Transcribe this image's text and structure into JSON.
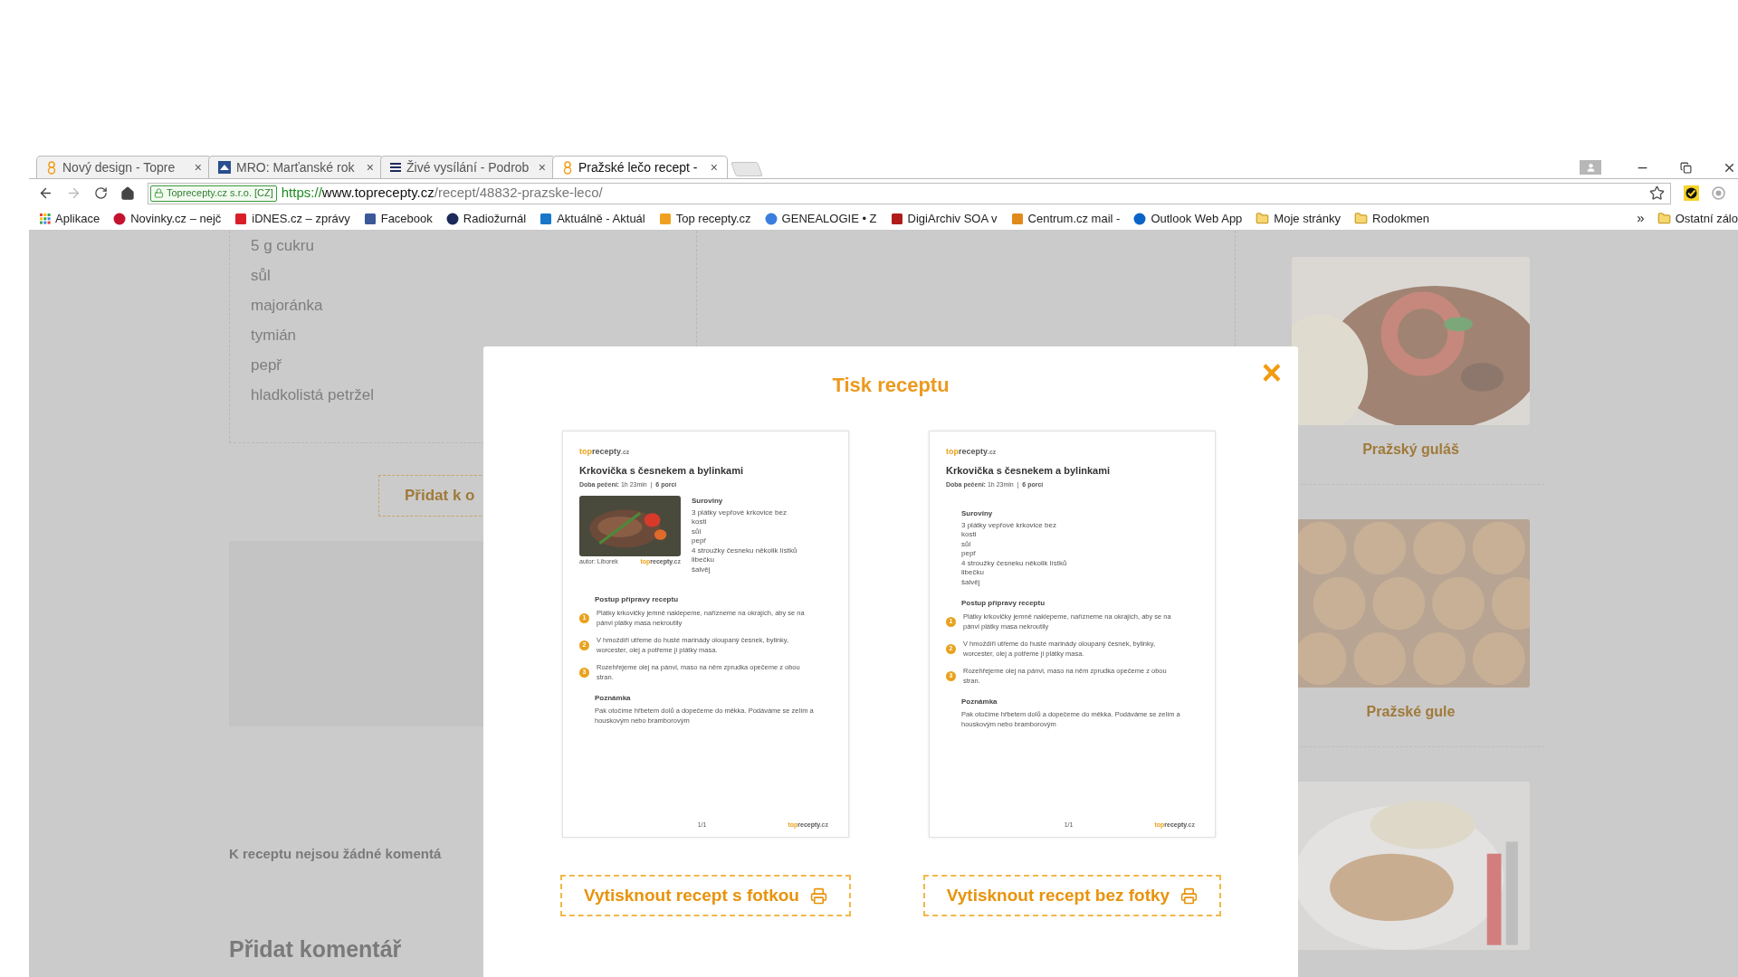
{
  "browser": {
    "tabs": [
      {
        "title": "Nový design - Topre",
        "selected": false
      },
      {
        "title": "MRO: Marťanské rok",
        "selected": false
      },
      {
        "title": "Živé vysílání - Podrob",
        "selected": false
      },
      {
        "title": "Pražské lečo recept -",
        "selected": true
      }
    ],
    "tab_close": "×",
    "identity": "Toprecepty.cz s.r.o. [CZ]",
    "url": {
      "scheme": "https://",
      "host": "www.toprecepty.cz",
      "path": "/recept/48832-prazske-leco/"
    },
    "bookmarks": [
      {
        "label": "Aplikace",
        "kind": "site"
      },
      {
        "label": "Novinky.cz – nejč",
        "kind": "site"
      },
      {
        "label": "iDNES.cz – zprávy",
        "kind": "site"
      },
      {
        "label": "Facebook",
        "kind": "site"
      },
      {
        "label": "Radiožurnál",
        "kind": "site"
      },
      {
        "label": "Aktuálně - Aktuál",
        "kind": "site"
      },
      {
        "label": "Top recepty.cz",
        "kind": "site"
      },
      {
        "label": "GENEALOGIE • Z",
        "kind": "site"
      },
      {
        "label": "DigiArchiv SOA v",
        "kind": "site"
      },
      {
        "label": "Centrum.cz mail -",
        "kind": "site"
      },
      {
        "label": "Outlook Web App",
        "kind": "site"
      },
      {
        "label": "Moje stránky",
        "kind": "folder"
      },
      {
        "label": "Rodokmen",
        "kind": "folder"
      }
    ],
    "more_bookmarks": "»",
    "other_bookmarks": "Ostatní zálo"
  },
  "page": {
    "ingredients": [
      "5 g cukru",
      "sůl",
      "majoránka",
      "tymián",
      "pepř",
      "hladkolistá petržel"
    ],
    "add_button": "Přidat k o",
    "no_comments": "K receptu nejsou žádné komentá",
    "add_comment": "Přidat komentář",
    "related": [
      {
        "title": "Pražský guláš",
        "kind": "goulash"
      },
      {
        "title": "Pražské gule",
        "kind": "balls"
      },
      {
        "kind": "cutlet"
      }
    ]
  },
  "modal": {
    "title": "Tisk receptu",
    "close": "×",
    "previews": [
      {
        "kind": "with_photo",
        "logo": {
          "top": "top",
          "rest": "recepty",
          "tld": ".cz"
        },
        "title": "Krkovička s česnekem a bylinkami",
        "meta": "**Doba pečení:** 1h 23min  |  **6 porcí**",
        "photo_author": "autor: Liborek",
        "photo_logo": {
          "top": "top",
          "rest": "recepty",
          "tld": ".cz"
        },
        "ingredients_heading": "Suroviny",
        "ingredients": [
          "3 plátky vepřové krkovice bez",
          "kosti",
          "sůl",
          "pepř",
          "4 stroužky česneku několik lístků",
          "libečku",
          "šalvěj"
        ],
        "steps_heading": "Postup přípravy receptu",
        "steps": [
          {
            "number": "1",
            "text": "Plátky krkovičky jemně naklepeme, nařízneme na okrajích, aby se na pánvi plátky masa nekroutily"
          },
          {
            "number": "2",
            "text": "V hmoždíři utřeme do husté marinády oloupaný česnek, bylinky, worcester, olej a potřeme ji plátky masa."
          },
          {
            "number": "3",
            "text": "Rozehřejeme olej na pánvi, maso na něm zprudka opečeme z obou stran."
          }
        ],
        "note_heading": "Poznámka",
        "note": "Pak otočíme hřbetem dolů a dopečeme do měkka. Podáváme se zelím a houskovým nebo bramborovým",
        "page": "1/1",
        "footer_logo": {
          "top": "top",
          "rest": "recepty",
          "tld": ".cz"
        }
      },
      {
        "kind": "text_only",
        "logo": {
          "top": "top",
          "rest": "recepty",
          "tld": ".cz"
        },
        "title": "Krkovička s česnekem a bylinkami",
        "meta": "**Doba pečení:** 1h 23min  |  **6 porcí**",
        "ingredients_heading": "Suroviny",
        "ingredients": [
          "3 plátky vepřové krkovice bez",
          "kosti",
          "sůl",
          "pepř",
          "4 stroužky česneku několik lístků",
          "libečku",
          "šalvěj"
        ],
        "steps_heading": "Postup přípravy receptu",
        "steps": [
          {
            "number": "1",
            "text": "Plátky krkovičky jemně naklepeme, nařízneme na okrajích, aby se na pánvi plátky masa nekroutily"
          },
          {
            "number": "2",
            "text": "V hmoždíři utřeme do husté marinády oloupaný česnek, bylinky, worcester, olej a potřeme ji plátky masa."
          },
          {
            "number": "3",
            "text": "Rozehřejeme olej na pánvi, maso na něm zprudka opečeme z obou stran."
          }
        ],
        "note_heading": "Poznámka",
        "note": "Pak otočíme hřbetem dolů a dopečeme do měkka. Podáváme se zelím a houskovým nebo bramborovým",
        "page": "1/1",
        "footer_logo": {
          "top": "top",
          "rest": "recepty",
          "tld": ".cz"
        }
      }
    ],
    "buttons": [
      "Vytisknout recept s fotkou",
      "Vytisknout recept bez fotky"
    ]
  }
}
